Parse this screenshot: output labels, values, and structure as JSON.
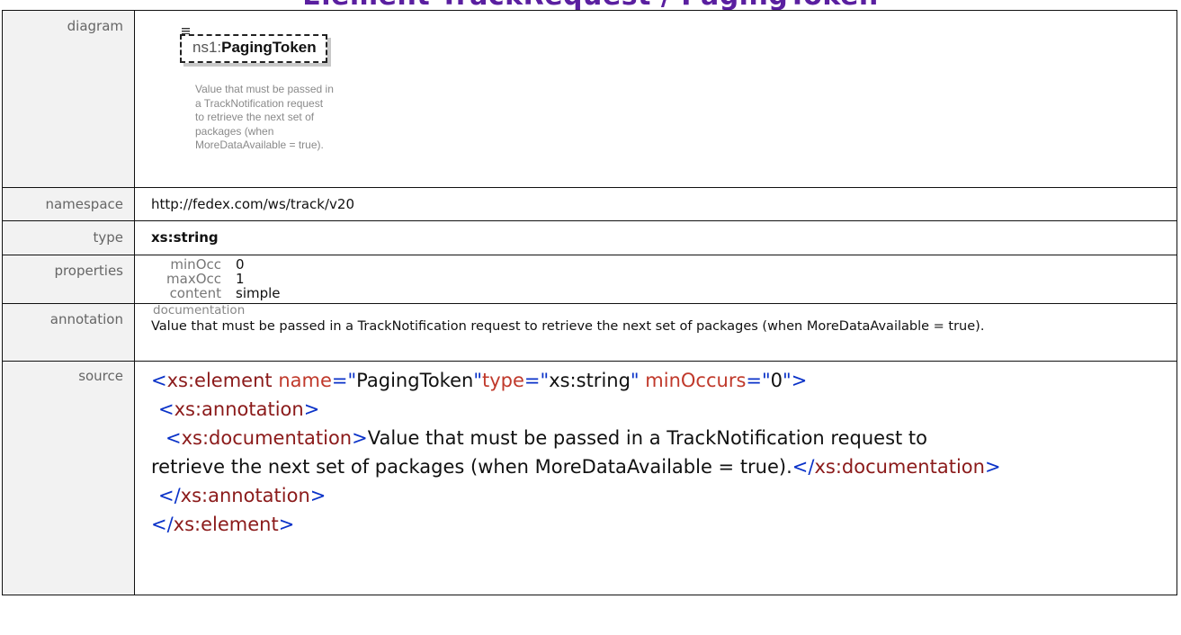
{
  "page_title": "Element TrackRequest / PagingToken",
  "rows": {
    "diagram": {
      "label": "diagram",
      "ns_prefix": "ns1:",
      "element_name": "PagingToken",
      "description_lines": [
        "Value that must be passed in",
        "a TrackNotification request",
        "to retrieve the next set of",
        "packages (when",
        "MoreDataAvailable = true)."
      ]
    },
    "namespace": {
      "label": "namespace",
      "value": "http://fedex.com/ws/track/v20"
    },
    "type": {
      "label": "type",
      "value": "xs:string"
    },
    "properties": {
      "label": "properties",
      "items": [
        {
          "key": "minOcc",
          "value": "0"
        },
        {
          "key": "maxOcc",
          "value": "1"
        },
        {
          "key": "content",
          "value": "simple"
        }
      ]
    },
    "annotation": {
      "label": "annotation",
      "heading": "documentation",
      "text": "Value that must be passed in a TrackNotification  request to retrieve the next set of packages (when MoreDataAvailable = true)."
    },
    "source": {
      "label": "source",
      "line1": {
        "open": "<",
        "el": "xs:element",
        "attr1": "name",
        "eq1": "=\"",
        "val1": "PagingToken",
        "q1": "\"",
        "attr2": "type",
        "eq2": "=\"",
        "val2": "xs:string",
        "q2": "\"",
        "attr3": "minOccurs",
        "eq3": "=\"",
        "val3": "0",
        "close": "\">"
      },
      "line2": {
        "open": "<",
        "el": "xs:annotation",
        "close": ">"
      },
      "line3": {
        "open": "<",
        "el": "xs:documentation",
        "close": ">",
        "text": "Value that must be passed in a TrackNotification request to"
      },
      "line4": {
        "text": "retrieve the next set of packages (when MoreDataAvailable = true).",
        "open": "</",
        "el": "xs:documentation",
        "close": ">"
      },
      "line5": {
        "open": "</",
        "el": "xs:annotation",
        "close": ">"
      },
      "line6": {
        "open": "</",
        "el": "xs:element",
        "close": ">"
      }
    }
  }
}
